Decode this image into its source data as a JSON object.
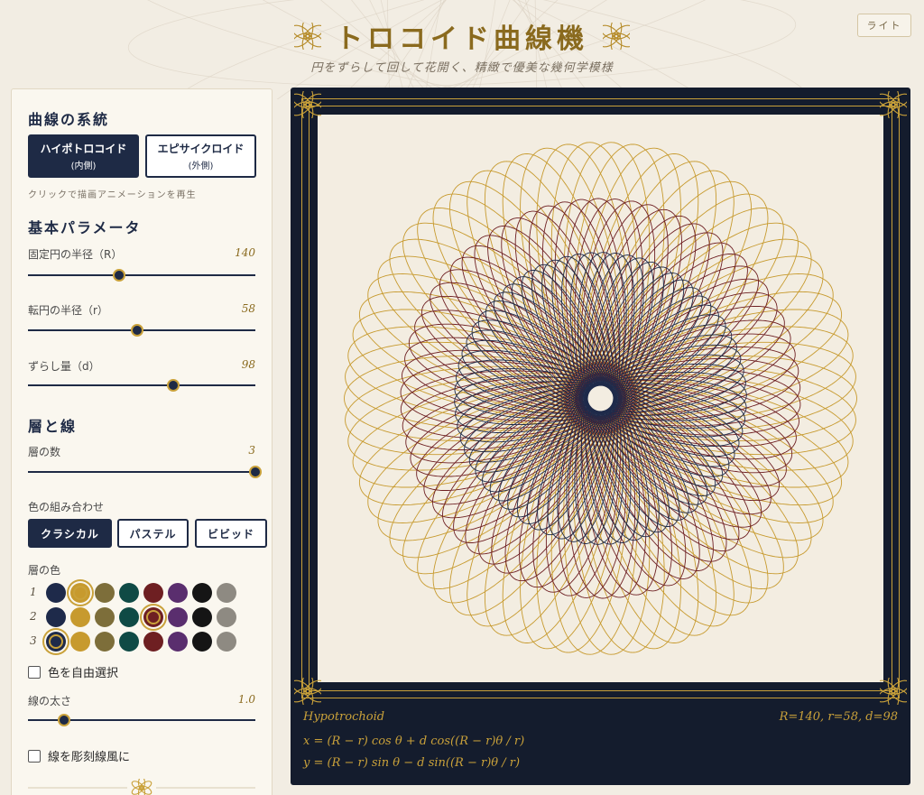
{
  "header": {
    "title": "トロコイド曲線機",
    "subtitle": "円をずらして回して花開く、精緻で優美な幾何学模様",
    "theme_button": "ライト"
  },
  "sidebar": {
    "family": {
      "title": "曲線の系統",
      "hypo_label": "ハイポトロコイド",
      "hypo_sub": "(内側)",
      "epi_label": "エピサイクロイド",
      "epi_sub": "(外側)",
      "hint": "クリックで描画アニメーションを再生",
      "active": "hypo"
    },
    "basic": {
      "title": "基本パラメータ",
      "R_label": "固定円の半径（R）",
      "R_value": "140",
      "R_fraction": 0.4,
      "r_label": "転円の半径（r）",
      "r_value": "58",
      "r_fraction": 0.48,
      "d_label": "ずらし量（d）",
      "d_value": "98",
      "d_fraction": 0.64
    },
    "layers": {
      "title": "層と線",
      "count_label": "層の数",
      "count_value": "3",
      "count_fraction": 1.0,
      "combo_label": "色の組み合わせ",
      "palettes": [
        "クラシカル",
        "パステル",
        "ビビッド"
      ],
      "active_palette": 0,
      "layer_color_label": "層の色",
      "row_numbers": [
        "1",
        "2",
        "3"
      ],
      "swatch_colors": [
        "#1e2a4a",
        "#c79a2e",
        "#7d6e3a",
        "#0f4a45",
        "#6e1f22",
        "#5a2e6e",
        "#151515",
        "#8e8a82"
      ],
      "selected": [
        1,
        4,
        0
      ],
      "free_select_label": "色を自由選択",
      "width_label": "線の太さ",
      "width_value": "1.0",
      "width_fraction": 0.16,
      "engrave_label": "線を彫刻線風に"
    }
  },
  "canvas": {
    "curve_name": "Hypotrochoid",
    "params_text": "R=140, r=58, d=98",
    "eq_x": "x = (R − r) cos θ + d cos((R − r)θ / r)",
    "eq_y": "y = (R − r) sin θ − d sin((R − r)θ / r)",
    "layer_colors": [
      "#c79a2e",
      "#6e1f22",
      "#1e2a4a"
    ],
    "R": 140,
    "r": 58,
    "d": 98
  }
}
